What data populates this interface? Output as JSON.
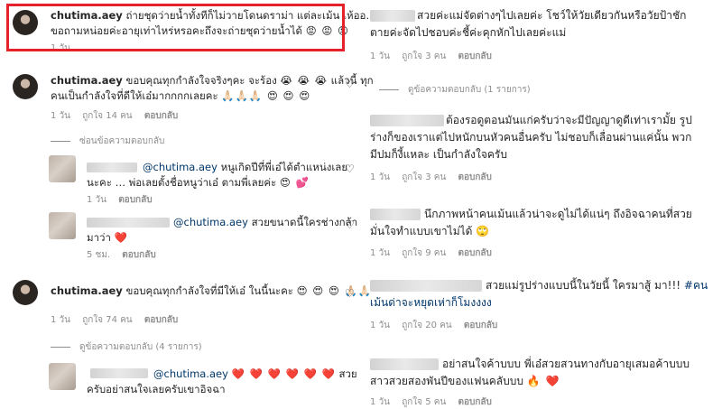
{
  "left": {
    "c1": {
      "username": "chutima.aey",
      "text1": "ถ่ายชุดว่ายน้ำทั้งทีก็ไม่วายโดนดราม่า แต่ละเม้น เห้ออ…",
      "text2": "ขอถามหน่อยค่ะอายุเท่าไหร่หรอคะถึงจะถ่ายชุดว่ายน้ำได้",
      "emoji": "😡 😡 😡",
      "time": "1 วัน"
    },
    "c2": {
      "username": "chutima.aey",
      "text1": "ขอบคุณทุกกำลังใจจริงๆคะ จะร้อง",
      "emoji1": "😭 😭 😭",
      "text1b": "แล้วนี้ ทุก",
      "text2": "คนเป็นกำลังใจที่ดีให้เอ๋มากกกกเลยคะ",
      "emoji2": "🙏🏻🙏🏻🙏🏻 😍 😍 😍",
      "time": "1 วัน",
      "likes": "ถูกใจ 14 คน",
      "reply": "ตอบกลับ",
      "hide_replies": "ซ่อนข้อความตอบกลับ"
    },
    "r1": {
      "mention": "@chutima.aey",
      "text1": "หนูเกิดปีที่พี่เอ๋ได้ตำแหน่งเลย",
      "text2": "นะคะ … พ่อเลยตั้งชื่อหนูว่าเอ๋ ตามพี่เลยค่ะ",
      "emoji": "😍 💕",
      "time": "1 วัน",
      "reply": "ตอบกลับ"
    },
    "r2": {
      "mention": "@chutima.aey",
      "text1": "สวยขนาดนี้ใครช่างกล้า",
      "text2": "มาว่า",
      "emoji": "❤️",
      "time": "5 ชม.",
      "reply": "ตอบกลับ"
    },
    "c3": {
      "username": "chutima.aey",
      "text": "ขอบคุณทุกกำลังใจที่มีให้เอ๋ ในนี้นะคะ",
      "emoji": "😍 😍 😍 🙏🏻🙏🏻",
      "time": "1 วัน",
      "likes": "ถูกใจ 74 คน",
      "reply": "ตอบกลับ",
      "view_replies": "ดูข้อความตอบกลับ (4 รายการ)"
    },
    "r3": {
      "mention": "@chutima.aey",
      "hearts": "❤️ ❤️ ❤️ ❤️ ❤️ ❤️",
      "text1end": "สวย",
      "text2": "ครับอย่าสนใจเลยครับเขาอิจฉา"
    }
  },
  "right": {
    "c1": {
      "text1": "สวยค่ะแม่จัดต่างๆไปเลยค่ะ โชว์ให้วัยเดียวกันหรือวัยป้าชัก",
      "text2": "ตายค่ะจัดไปชอบค่ะชี้ค่ะคุกหักไปเลยค่ะแม่",
      "time": "1 วัน",
      "likes": "ถูกใจ 3 คน",
      "reply": "ตอบกลับ",
      "view_replies": "ดูข้อความตอบกลับ (1 รายการ)"
    },
    "c2": {
      "text1": "ต้องรอดูตอนมันแก่ครับว่าจะมีปัญญาดูดีเท่าเรามั้ย รูป",
      "text2": "ร่างก็ของเราแต่ไปหนักบนหัวคนอื่นครับ ไม่ชอบก็เลื่อนผ่านแค่นั้น พวก",
      "text3": "มีปมก็งี้แหละ เป็นกำลังใจครับ",
      "time": "1 วัน",
      "likes": "ถูกใจ 3 คน",
      "reply": "ตอบกลับ"
    },
    "c3": {
      "text1": "นึกภาพหน้าคนเม้นแล้วน่าจะดูไม่ได้แน่ๆ ถึงอิจฉาคนที่สวย",
      "text2": "มั่นใจทำแบบเขาไม่ได้",
      "emoji": "🙄",
      "time": "1 วัน",
      "likes": "ถูกใจ 9 คน",
      "reply": "ตอบกลับ"
    },
    "c4": {
      "text1": "สวยแม่รูปร่างแบบนี้ในวัยนี้ ใครมาสู้ มา!!!",
      "hashtag1": "#คน",
      "hashtag2": "เม้นด่าจะหยุดเห่าก็โมงงงง",
      "time": "1 วัน",
      "likes": "ถูกใจ 20 คน",
      "reply": "ตอบกลับ"
    },
    "c5": {
      "text1": "อย่าสนใจค้าบบบ พี่เอ๋สวยสวนทางกับอายุเสมอค้าบบบ",
      "text2": "สาวสวยสองพันปีของแฟนคลับบบ",
      "emoji": "🔥 ❤️",
      "time": "1 วัน",
      "likes": "ถูกใจ 5 คน",
      "reply": "ตอบกลับ"
    }
  },
  "colors": {
    "highlight": "#e5222b",
    "link": "#00376b",
    "meta": "#8e8e8e"
  }
}
